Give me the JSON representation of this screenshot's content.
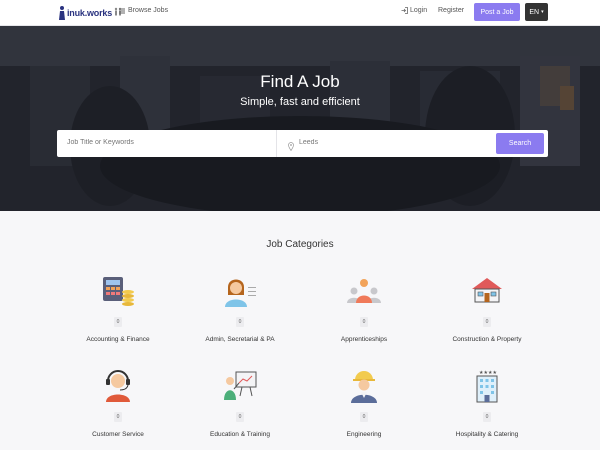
{
  "colors": {
    "accent": "#8b7bf0",
    "brand_blue": "#2a3380",
    "brand_red": "#e53030",
    "lang_bg": "#333333"
  },
  "nav": {
    "logo_text": "inuk.works",
    "browse_label": "Browse Jobs",
    "login_label": "Login",
    "register_label": "Register",
    "post_label": "Post a Job",
    "lang_label": "EN"
  },
  "hero": {
    "title": "Find A Job",
    "subtitle": "Simple, fast and efficient",
    "keyword_placeholder": "Job Title or Keywords",
    "location_value": "Leeds",
    "search_label": "Search"
  },
  "categories": {
    "title": "Job Categories",
    "items": [
      {
        "name": "Accounting & Finance",
        "count": "0",
        "icon": "calculator-coins-icon"
      },
      {
        "name": "Admin, Secretarial & PA",
        "count": "0",
        "icon": "secretary-icon"
      },
      {
        "name": "Apprenticeships",
        "count": "0",
        "icon": "group-people-icon"
      },
      {
        "name": "Construction & Property",
        "count": "0",
        "icon": "house-icon"
      },
      {
        "name": "Customer Service",
        "count": "0",
        "icon": "headset-agent-icon"
      },
      {
        "name": "Education & Training",
        "count": "0",
        "icon": "teacher-board-icon"
      },
      {
        "name": "Engineering",
        "count": "0",
        "icon": "engineer-helmet-icon"
      },
      {
        "name": "Hospitality & Catering",
        "count": "0",
        "icon": "hotel-icon"
      }
    ]
  }
}
